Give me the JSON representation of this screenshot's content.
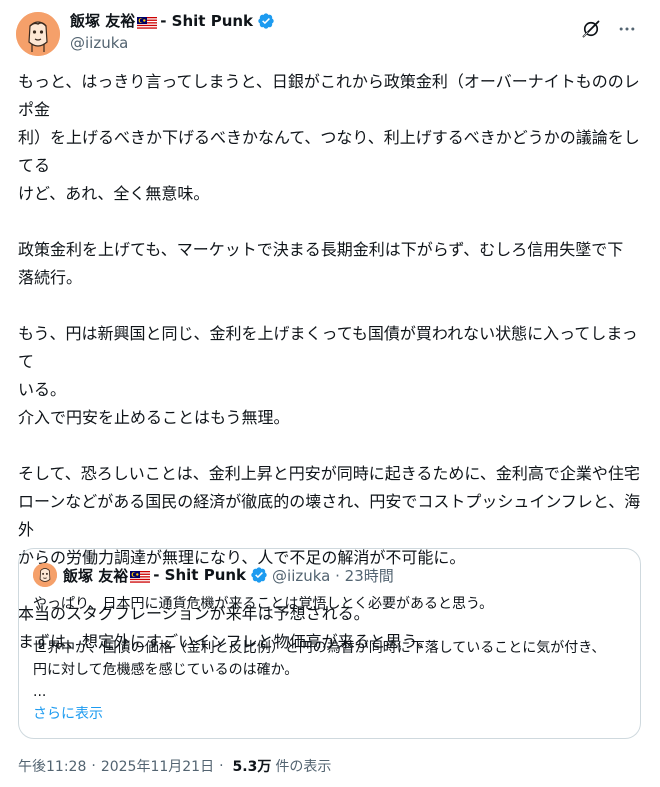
{
  "author": {
    "name": "飯塚 友裕",
    "suffix": "- Shit Punk",
    "handle": "@iizuka"
  },
  "tweet": {
    "paragraphs": [
      [
        "もっと、はっきり言ってしまうと、日銀がこれから政策金利（オーバーナイトもののレポ金",
        "利）を上げるべきか下げるべきかなんて、つなり、利上げするべきかどうかの議論をしてる",
        "けど、あれ、全く無意味。"
      ],
      [
        "政策金利を上げても、マーケットで決まる長期金利は下がらず、むしろ信用失墜で下",
        "落続行。"
      ],
      [
        "もう、円は新興国と同じ、金利を上げまくっても国債が買われない状態に入ってしまって",
        "いる。",
        "介入で円安を止めることはもう無理。"
      ],
      [
        "そして、恐ろしいことは、金利上昇と円安が同時に起きるために、金利高で企業や住宅",
        "ローンなどがある国民の経済が徹底的の壊され、円安でコストプッシュインフレと、海外",
        "からの労働力調達が無理になり、人で不足の解消が不可能に。"
      ],
      [
        "本当のスタグフレーションが来年は予想される。",
        "まずは、想定外にすごいインフレと物価高が来ると思う。"
      ]
    ]
  },
  "quote": {
    "name": "飯塚 友裕",
    "suffix": "- Shit Punk",
    "handle": "@iizuka · 23時間",
    "lines": [
      "やっぱり、日本円に通貨危機が来ることは覚悟しとく必要があると思う。",
      "",
      "世界中が、国債の価格（金利と反比例）と円の為替が同時に下落していることに気が付き、",
      "円に対して危機感を感じているのは確か。",
      "..."
    ],
    "show_more": "さらに表示"
  },
  "meta": {
    "time": "午後11:28",
    "date": "2025年11月21日",
    "views": "5.3万",
    "views_label": "件の表示"
  },
  "colors": {
    "verified": "#1d9bf0",
    "link": "#1d9bf0",
    "secondary_text": "#536471",
    "border": "#cfd9de"
  },
  "icons": [
    "verified-badge-icon",
    "grok-icon",
    "more-icon",
    "malaysia-flag-icon"
  ]
}
